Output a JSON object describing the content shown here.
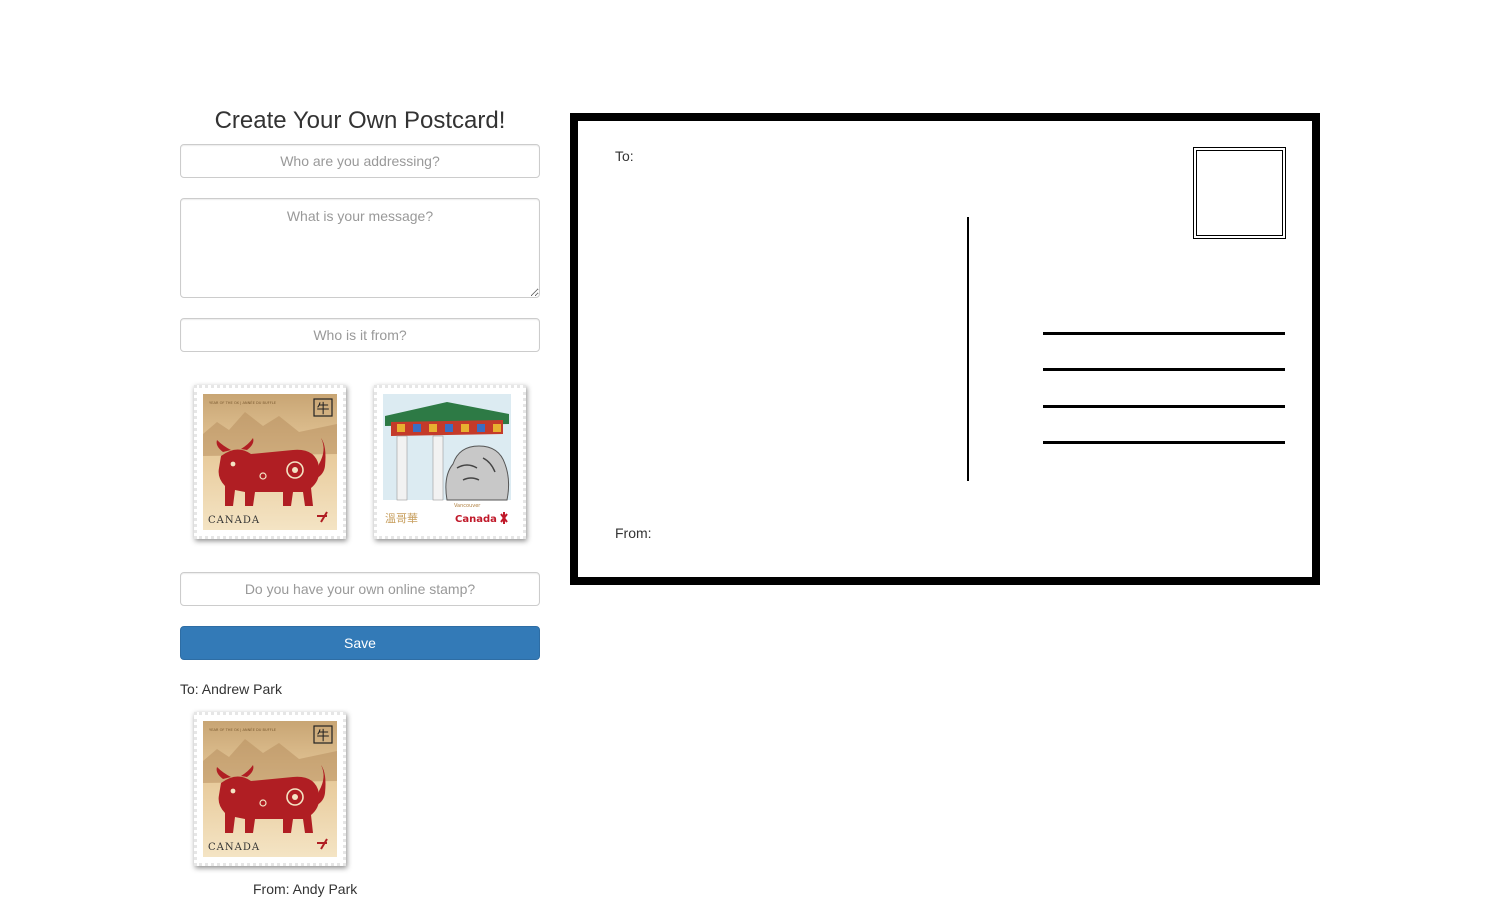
{
  "form": {
    "title": "Create Your Own Postcard!",
    "address_placeholder": "Who are you addressing?",
    "message_placeholder": "What is your message?",
    "from_placeholder": "Who is it from?",
    "own_stamp_placeholder": "Do you have your own online stamp?",
    "save_label": "Save"
  },
  "stamps": [
    {
      "icon": "ox-stamp-icon",
      "top_text": "YEAR OF THE OX | ANNÉE DU BUFFLE",
      "glyph": "牛",
      "country": "CANADA"
    },
    {
      "icon": "vancouver-gate-stamp-icon",
      "city": "Vancouver",
      "city_chinese": "溫哥華",
      "country": "Canada"
    }
  ],
  "saved": {
    "to_text": "To: Andrew Park",
    "from_text": "From: Andy Park",
    "stamp": {
      "top_text": "YEAR OF THE OX | ANNÉE DU BUFFLE",
      "glyph": "牛",
      "country": "CANADA"
    }
  },
  "postcard": {
    "to_label": "To:",
    "from_label": "From:",
    "address_line_count": 4
  },
  "colors": {
    "primary": "#337ab7",
    "ox_red": "#b01e23",
    "stamp_gold": "#e8cb9c"
  }
}
